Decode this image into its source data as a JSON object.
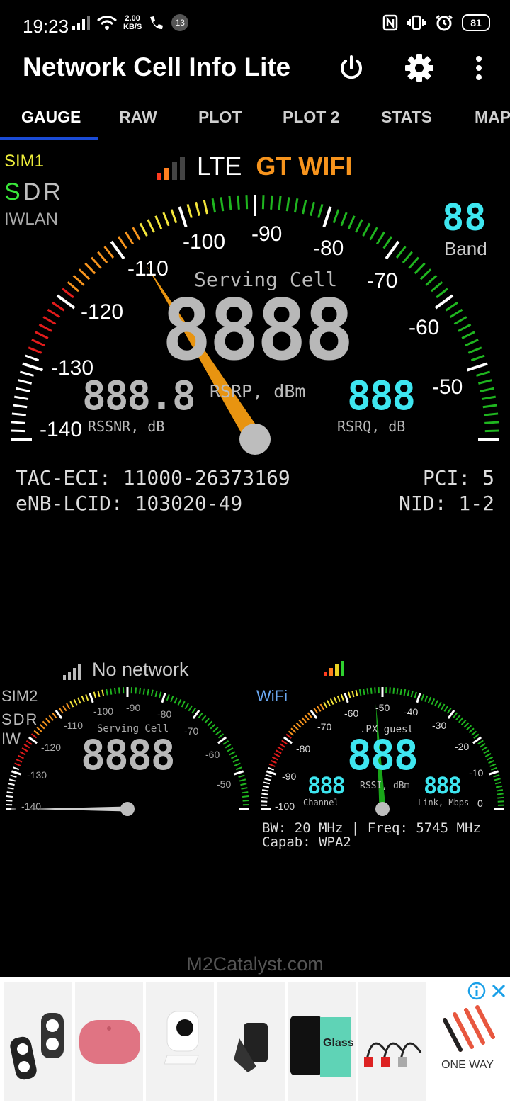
{
  "status": {
    "time": "19:23",
    "speed_value": "2.00",
    "speed_unit": "KB/S",
    "notif_count": "13",
    "battery": "81"
  },
  "app": {
    "title": "Network Cell Info Lite"
  },
  "tabs": [
    "GAUGE",
    "RAW",
    "PLOT",
    "PLOT 2",
    "STATS",
    "MAP"
  ],
  "sim1": {
    "label": "SIM1",
    "sdr_s": "S",
    "sdr_rest": "DR",
    "iwlan": "IWLAN",
    "tech": "LTE",
    "operator": "GT WIFI",
    "band_value": "88",
    "band_label": "Band",
    "serving_cell": "Serving Cell",
    "main_value": "8888",
    "main_unit": "RSRP, dBm",
    "rssnr_value": "888.8",
    "rssnr_label": "RSSNR, dB",
    "rsrq_value": "888",
    "rsrq_label": "RSRQ, dB",
    "scale": [
      "-140",
      "-130",
      "-120",
      "-110",
      "-100",
      "-90",
      "-80",
      "-70",
      "-60",
      "-50"
    ],
    "needle_value": -111,
    "tac_eci": "TAC-ECI: 11000-26373169",
    "enb_lcid": "eNB-LCID: 103020-49",
    "pci": "PCI: 5",
    "nid": "NID: 1-2"
  },
  "sim2": {
    "label": "SIM2",
    "sdr": "SDR",
    "iw": "IW",
    "status": "No network",
    "serving_cell": "Serving Cell",
    "value": "8888",
    "scale": [
      "-140",
      "-130",
      "-120",
      "-110",
      "-100",
      "-90",
      "-80",
      "-70",
      "-60",
      "-50"
    ]
  },
  "wifi": {
    "label": "WiFi",
    "ssid": ".PX_guest",
    "value": "888",
    "rssi_label": "RSSI, dBm",
    "channel_value": "888",
    "channel_label": "Channel",
    "link_value": "888",
    "link_label": "Link, Mbps",
    "scale": [
      "-100",
      "-90",
      "-80",
      "-70",
      "-60",
      "-50",
      "-40",
      "-30",
      "-20",
      "-10",
      "0"
    ],
    "needle_value": -52,
    "bw_freq": "BW: 20 MHz | Freq: 5745 MHz",
    "capab": "Capab: WPA2"
  },
  "footer": {
    "brand": "M2Catalyst.com"
  },
  "ad": {
    "brand_text": "ONE WAY",
    "glass_text": "Glass"
  },
  "colors": {
    "accent": "#f7941d",
    "cyan": "#3ee6f0",
    "tab_underline": "#1a4bd6",
    "green": "#19a619"
  }
}
